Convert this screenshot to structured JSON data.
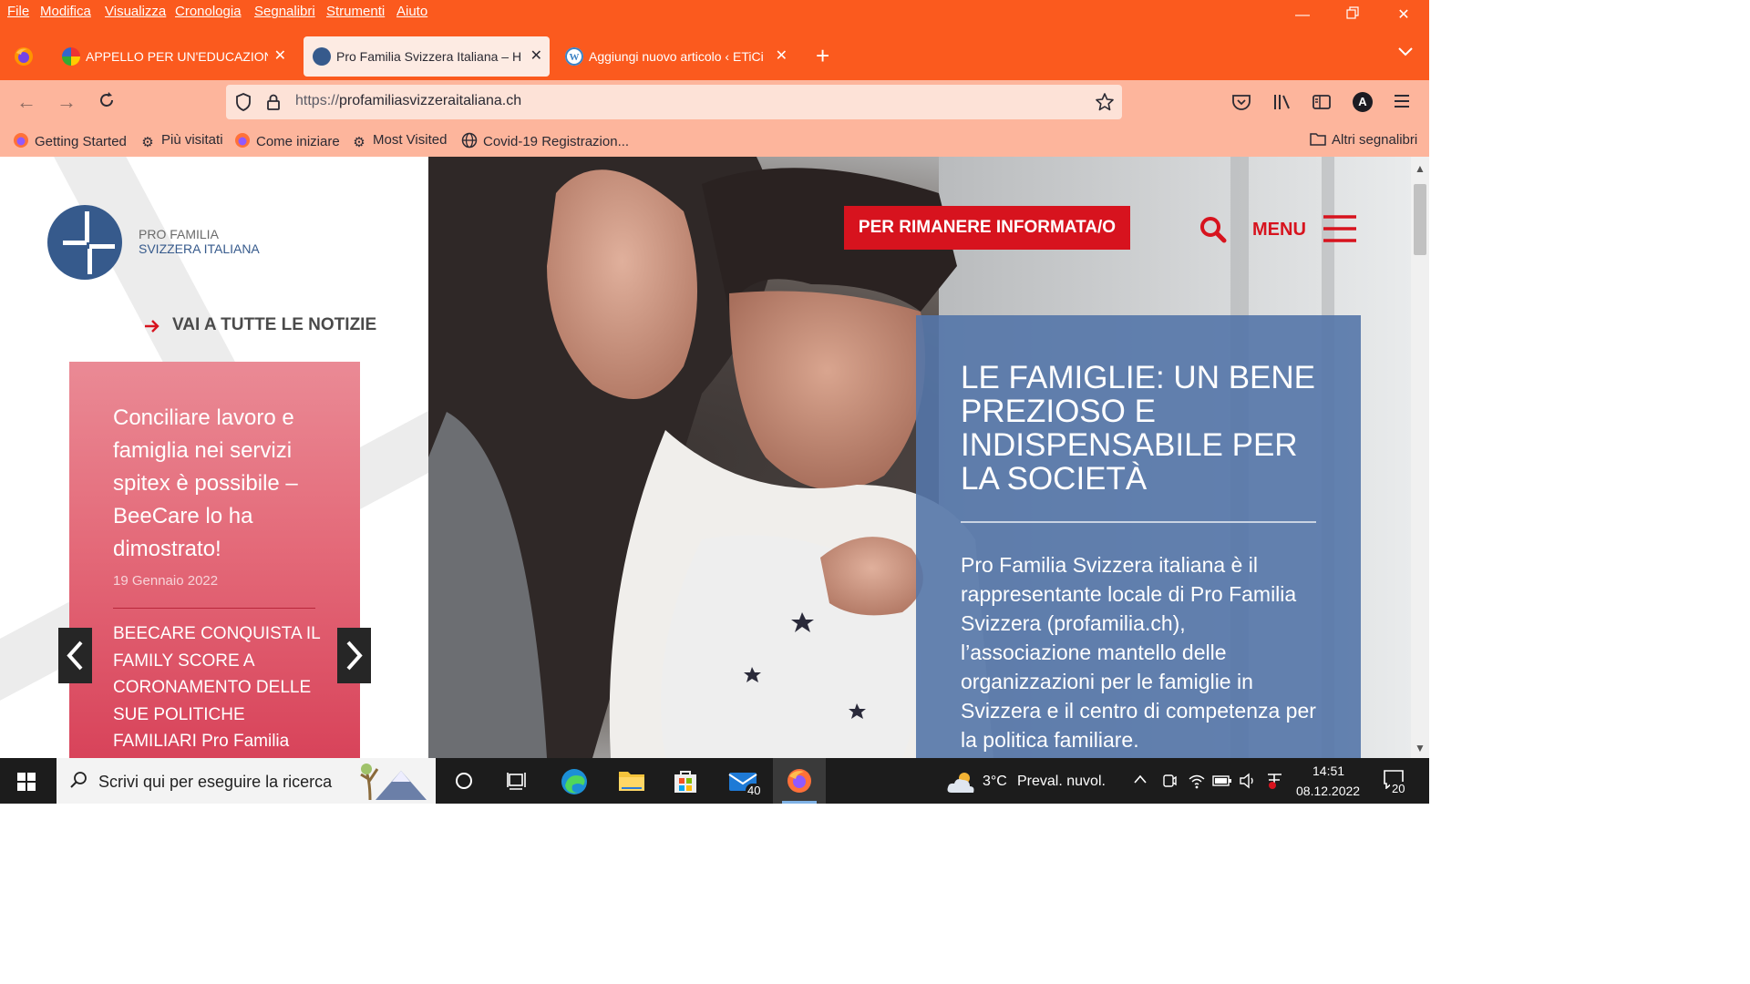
{
  "menubar": {
    "items": [
      "File",
      "Modifica",
      "Visualizza",
      "Cronologia",
      "Segnalibri",
      "Strumenti",
      "Aiuto"
    ]
  },
  "tabs": [
    {
      "title": "APPELLO PER UN'EDUCAZIONE",
      "active": false
    },
    {
      "title": "Pro Familia Svizzera Italiana – H",
      "active": true
    },
    {
      "title": "Aggiungi nuovo articolo ‹ ETiCi",
      "active": false
    }
  ],
  "navbar": {
    "url_proto": "https://",
    "url_host": "profamiliasvizzeraitaliana.ch",
    "profile_initial": "A"
  },
  "bookmarks": {
    "items": [
      "Getting Started",
      "Più visitati",
      "Come iniziare",
      "Most Visited",
      "Covid-19 Registrazion..."
    ],
    "other": "Altri segnalibri"
  },
  "site": {
    "logo_line1": "PRO FAMILIA",
    "logo_line2": "SVIZZERA ITALIANA",
    "all_news_link": "VAI A TUTTE LE NOTIZIE",
    "subscribe_button": "PER RIMANERE INFORMATA/O",
    "menu_label": "MENU",
    "news": {
      "title": "Conciliare lavoro e famiglia nei servizi spitex è possibile – BeeCare lo ha dimostrato!",
      "date": "19 Gennaio 2022",
      "next_title": "BEECARE CONQUISTA IL FAMILY SCORE A CORONAMENTO DELLE SUE POLITICHE FAMILIARI Pro Familia"
    },
    "hero": {
      "headline": "LE FAMIGLIE: UN BENE PREZIOSO E INDISPENSABILE PER LA SOCIETÀ",
      "body": "Pro Familia Svizzera italiana è il rappresentante locale di Pro Familia Svizzera (profamilia.ch), l’associazione mantello delle organizzazioni per le famiglie in Svizzera e il centro di competenza per la politica familiare."
    }
  },
  "taskbar": {
    "search_placeholder": "Scrivi qui per eseguire la ricerca",
    "weather_temp": "3°C",
    "weather_desc": "Preval. nuvol.",
    "time": "14:51",
    "date": "08.12.2022",
    "mail_badge": "40",
    "notif_badge": "20"
  },
  "colors": {
    "firefox_orange": "#fb5a1e",
    "navbar_peach": "#fdb59c",
    "brand_red": "#d7131e",
    "brand_blue": "#365a8c",
    "news_pink": "#e46b7a",
    "hero_panel": "#5a7bab"
  }
}
